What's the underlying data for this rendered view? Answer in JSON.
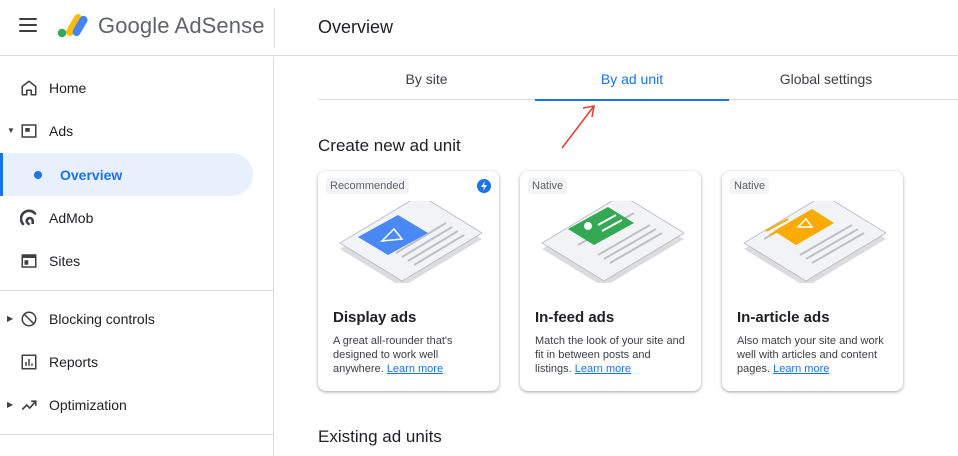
{
  "app": {
    "brand": "Google AdSense",
    "page_title": "Overview"
  },
  "sidebar": {
    "items": [
      {
        "label": "Home",
        "icon": "home-icon"
      },
      {
        "label": "Ads",
        "icon": "ads-icon"
      },
      {
        "label": "Overview",
        "icon": "dot-icon",
        "active": true
      },
      {
        "label": "AdMob",
        "icon": "admob-icon"
      },
      {
        "label": "Sites",
        "icon": "sites-icon"
      },
      {
        "label": "Blocking controls",
        "icon": "block-icon"
      },
      {
        "label": "Reports",
        "icon": "reports-icon"
      },
      {
        "label": "Optimization",
        "icon": "trend-icon"
      }
    ]
  },
  "tabs": [
    {
      "label": "By site"
    },
    {
      "label": "By ad unit",
      "active": true
    },
    {
      "label": "Global settings"
    }
  ],
  "sections": {
    "create": "Create new ad unit",
    "existing": "Existing ad units"
  },
  "cards": [
    {
      "badge": "Recommended",
      "title": "Display ads",
      "desc": "A great all-rounder that's designed to work well anywhere.",
      "link": "Learn more",
      "accent": "#4a89f3"
    },
    {
      "badge": "Native",
      "title": "In-feed ads",
      "desc": "Match the look of your site and fit in between posts and listings.",
      "link": "Learn more",
      "accent": "#34a853"
    },
    {
      "badge": "Native",
      "title": "In-article ads",
      "desc": "Also match your site and work well with articles and content pages.",
      "link": "Learn more",
      "accent": "#f9ab00"
    }
  ],
  "colors": {
    "primary": "#1a73e8",
    "annotation_arrow": "#e53935"
  }
}
